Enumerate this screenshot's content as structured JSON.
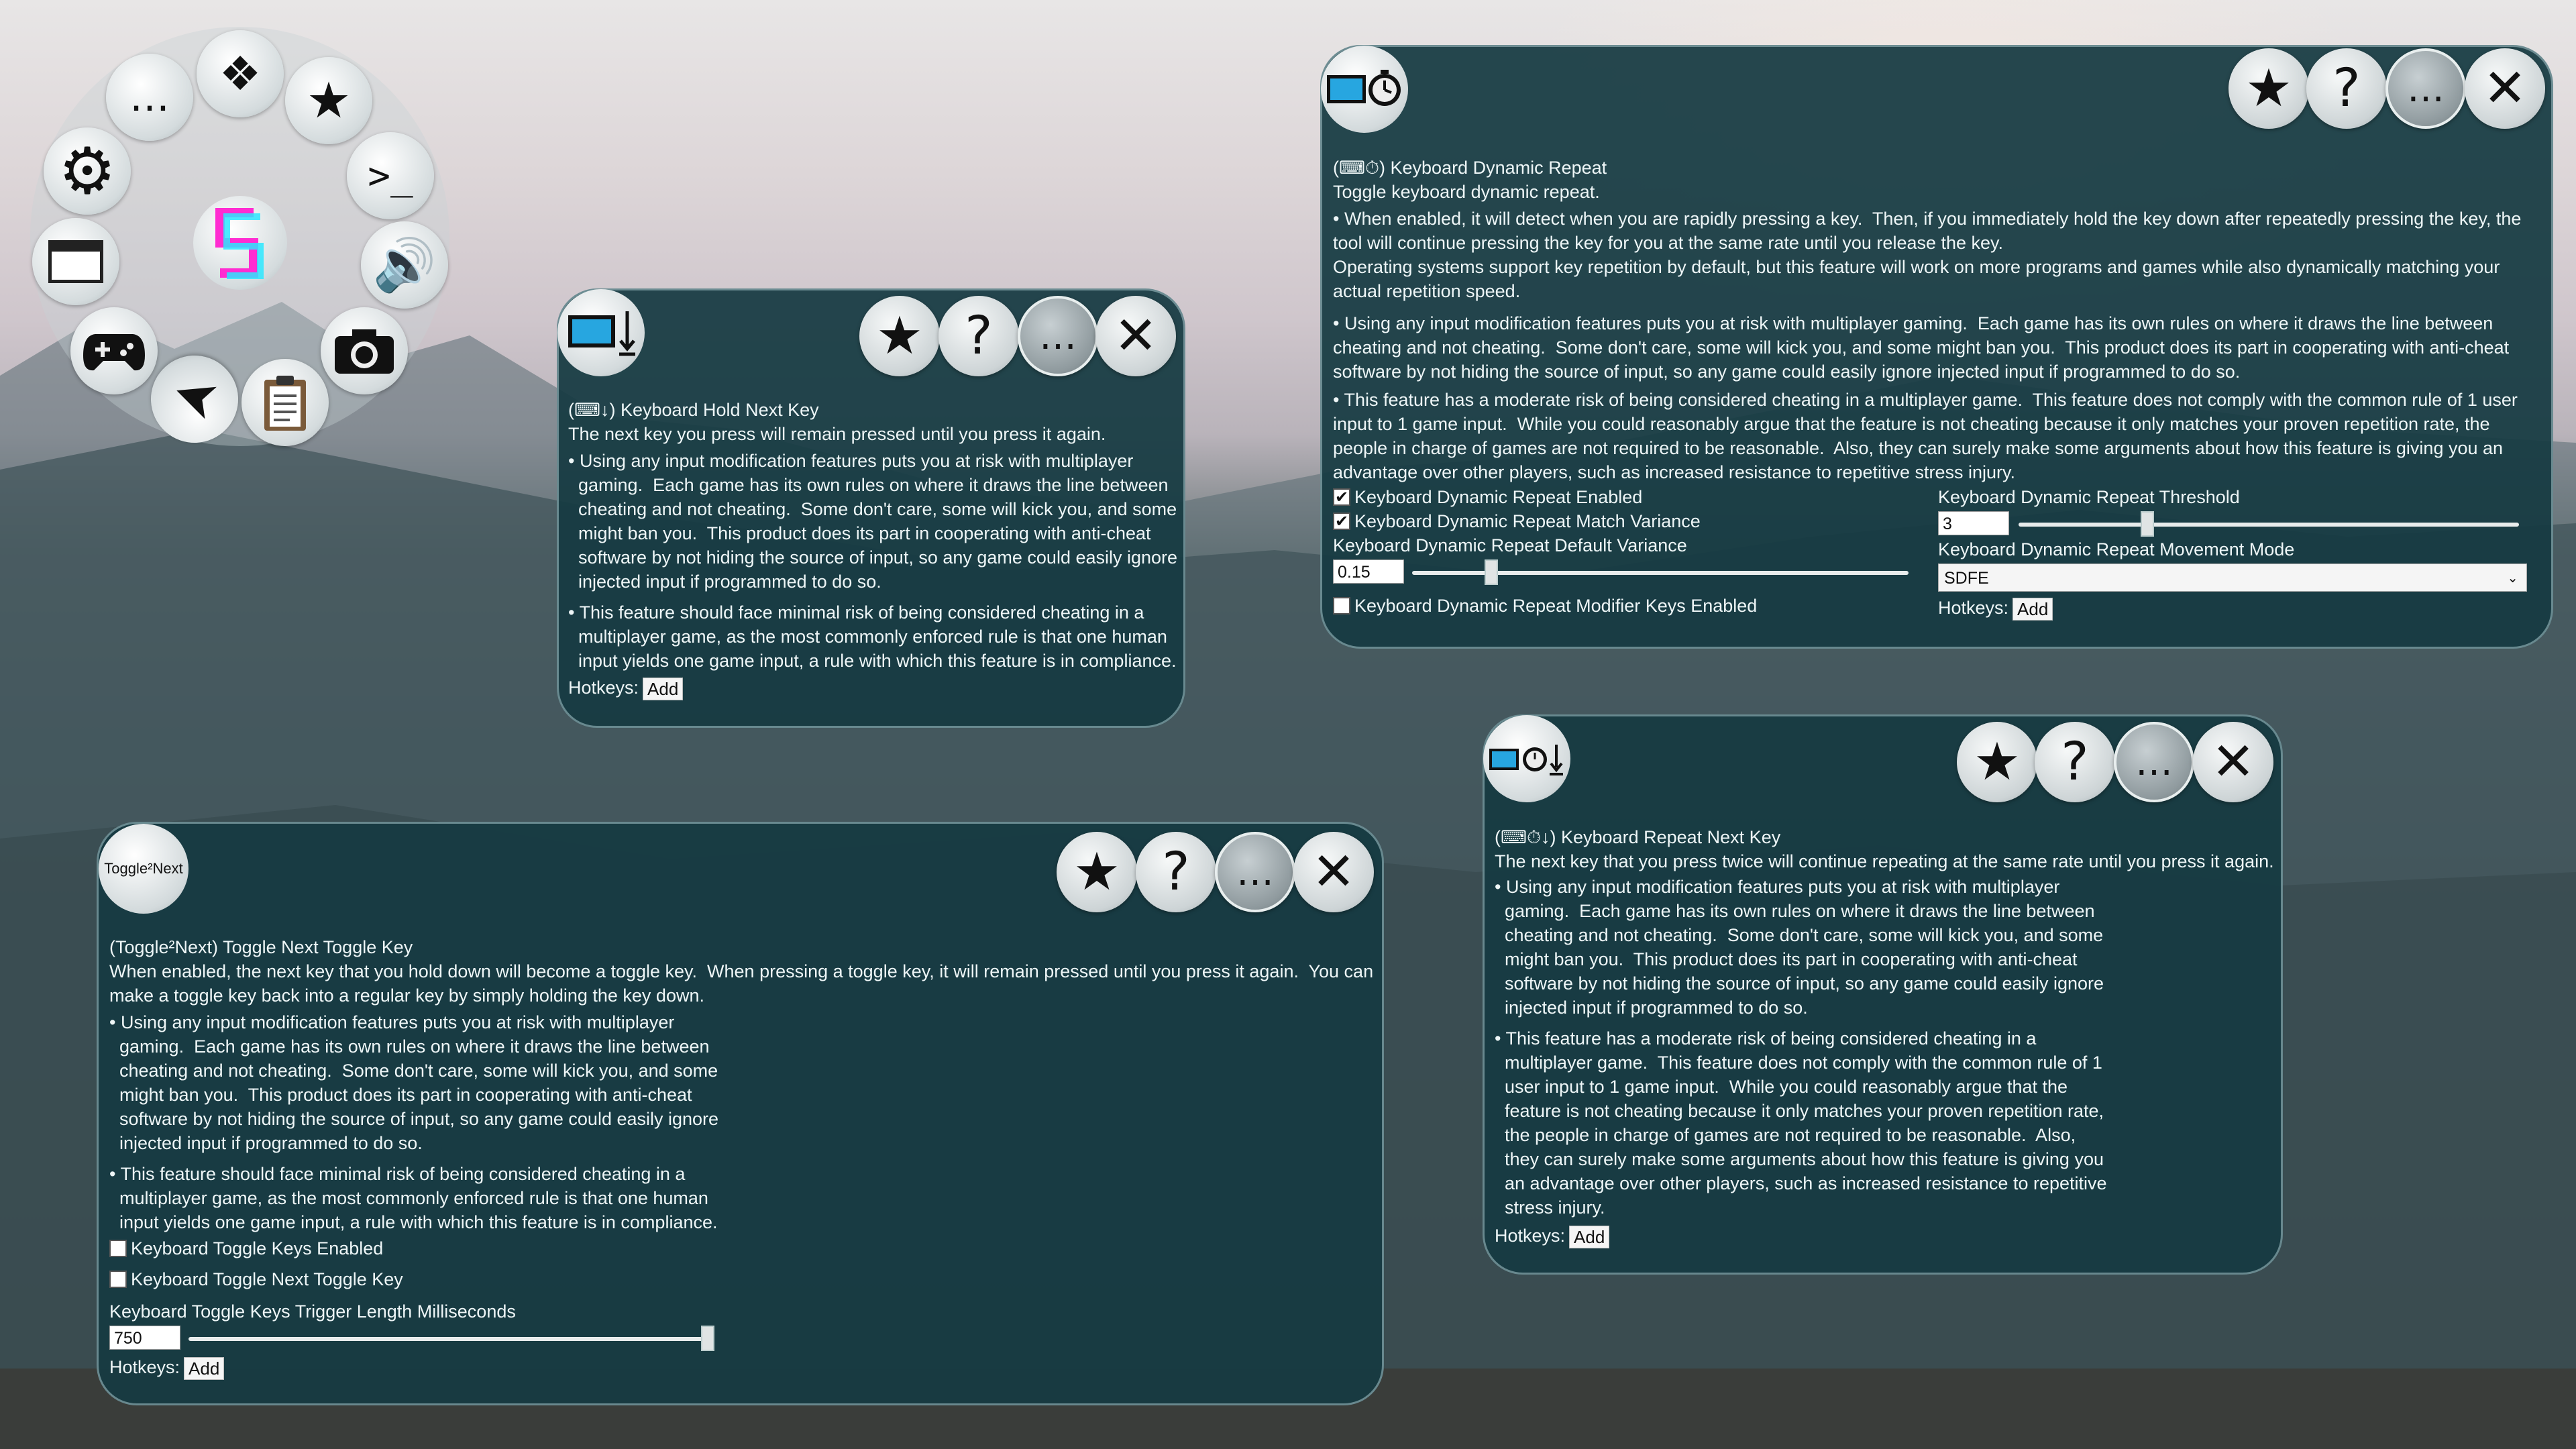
{
  "radial_menu": {
    "items": [
      {
        "name": "more-icon",
        "glyph": "…"
      },
      {
        "name": "dpad-icon",
        "glyph": "❖"
      },
      {
        "name": "star-icon",
        "glyph": "★"
      },
      {
        "name": "settings-icon",
        "glyph": "⚙"
      },
      {
        "name": "terminal-icon",
        "glyph": ">_"
      },
      {
        "name": "window-icon",
        "glyph": ""
      },
      {
        "name": "speaker-icon",
        "glyph": "🔊"
      },
      {
        "name": "gamepad-icon",
        "glyph": ""
      },
      {
        "name": "camera-icon",
        "glyph": ""
      },
      {
        "name": "cursor-icon",
        "glyph": "➤"
      },
      {
        "name": "clipboard-icon",
        "glyph": ""
      }
    ]
  },
  "common": {
    "hotkeys_label": "Hotkeys:",
    "add_label": "Add",
    "star": "★",
    "help": "?",
    "more": "…",
    "close": "✕"
  },
  "hold_next": {
    "title": "(⌨↓)  Keyboard Hold Next Key",
    "desc": "The next key you press will remain pressed until you press it again.",
    "warn1": "• Using any input modification features puts you at risk with multiplayer\n  gaming.  Each game has its own rules on where it draws the line between\n  cheating and not cheating.  Some don't care, some will kick you, and some\n  might ban you.  This product does its part in cooperating with anti-cheat\n  software by not hiding the source of input, so any game could easily ignore\n  injected input if programmed to do so.",
    "warn2": "• This feature should face minimal risk of being considered cheating in a\n  multiplayer game, as the most commonly enforced rule is that one human\n  input yields one game input, a rule with which this feature is in compliance."
  },
  "dynamic_repeat": {
    "title": "(⌨⏱)  Keyboard Dynamic Repeat",
    "desc": "Toggle keyboard dynamic repeat.",
    "p1": "• When enabled, it will detect when you are rapidly pressing a key.  Then, if you immediately hold the key down after repeatedly pressing the key, the\ntool will continue pressing the key for you at the same rate until you release the key.\nOperating systems support key repetition by default, but this feature will work on more programs and games while also dynamically matching your\nactual repetition speed.",
    "warn1": "• Using any input modification features puts you at risk with multiplayer gaming.  Each game has its own rules on where it draws the line between\ncheating and not cheating.  Some don't care, some will kick you, and some might ban you.  This product does its part in cooperating with anti-cheat\nsoftware by not hiding the source of input, so any game could easily ignore injected input if programmed to do so.",
    "warn2": "• This feature has a moderate risk of being considered cheating in a multiplayer game.  This feature does not comply with the common rule of 1 user\ninput to 1 game input.  While you could reasonably argue that the feature is not cheating because it only matches your proven repetition rate, the\npeople in charge of games are not required to be reasonable.  Also, they can surely make some arguments about how this feature is giving you an\nadvantage over other players, such as increased resistance to repetitive stress injury.",
    "enabled_label": "Keyboard Dynamic Repeat Enabled",
    "enabled_checked": "✔",
    "match_label": "Keyboard Dynamic Repeat Match Variance",
    "match_checked": "✔",
    "variance_label": "Keyboard Dynamic Repeat Default Variance",
    "variance_value": "0.15",
    "variance_fraction": 0.15,
    "modifier_label": "Keyboard Dynamic Repeat Modifier Keys Enabled",
    "threshold_label": "Keyboard Dynamic Repeat Threshold",
    "threshold_value": "3",
    "threshold_fraction": 0.25,
    "mode_label": "Keyboard Dynamic Repeat Movement Mode",
    "mode_value": "SDFE"
  },
  "toggle_next": {
    "icon_text": "Toggle²Next",
    "title": "(Toggle²Next)  Toggle Next Toggle Key",
    "desc": "When enabled, the next key that you hold down will become a toggle key.  When pressing a toggle key, it will remain pressed until you press it again.  You can\nmake a toggle key back into a regular key by simply holding the key down.",
    "warn1": "• Using any input modification features puts you at risk with multiplayer\n  gaming.  Each game has its own rules on where it draws the line between\n  cheating and not cheating.  Some don't care, some will kick you, and some\n  might ban you.  This product does its part in cooperating with anti-cheat\n  software by not hiding the source of input, so any game could easily ignore\n  injected input if programmed to do so.",
    "warn2": "• This feature should face minimal risk of being considered cheating in a\n  multiplayer game, as the most commonly enforced rule is that one human\n  input yields one game input, a rule with which this feature is in compliance.",
    "toggle_enabled_label": "Keyboard Toggle Keys Enabled",
    "toggle_next_label": "Keyboard Toggle Next Toggle Key",
    "trigger_label": "Keyboard Toggle Keys Trigger Length Milliseconds",
    "trigger_value": "750",
    "trigger_fraction": 1.0
  },
  "repeat_next": {
    "title": "(⌨⏱↓)  Keyboard Repeat Next Key",
    "desc": "The next key that you press twice will continue repeating at the same rate until you press it again.",
    "warn1": "• Using any input modification features puts you at risk with multiplayer\n  gaming.  Each game has its own rules on where it draws the line between\n  cheating and not cheating.  Some don't care, some will kick you, and some\n  might ban you.  This product does its part in cooperating with anti-cheat\n  software by not hiding the source of input, so any game could easily ignore\n  injected input if programmed to do so.",
    "warn2": "• This feature has a moderate risk of being considered cheating in a\n  multiplayer game.  This feature does not comply with the common rule of 1\n  user input to 1 game input.  While you could reasonably argue that the\n  feature is not cheating because it only matches your proven repetition rate,\n  the people in charge of games are not required to be reasonable.  Also,\n  they can surely make some arguments about how this feature is giving you\n  an advantage over other players, such as increased resistance to repetitive\n  stress injury."
  }
}
